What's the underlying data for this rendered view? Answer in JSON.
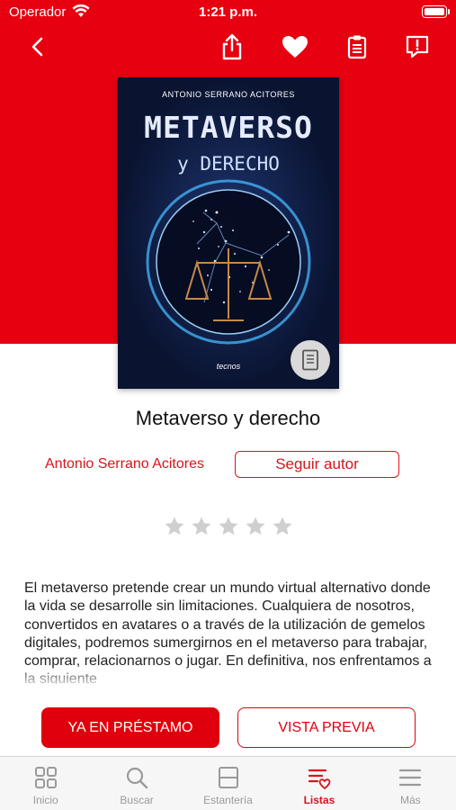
{
  "status_bar": {
    "carrier": "Operador",
    "time": "1:21 p.m."
  },
  "colors": {
    "brand_red": "#e60010",
    "accent_red": "#d8141c"
  },
  "nav": {
    "back_icon": "chevron-left-icon",
    "share_icon": "share-icon",
    "favorite_icon": "heart-icon",
    "list_icon": "clipboard-icon",
    "report_icon": "report-icon"
  },
  "book": {
    "cover_author": "ANTONIO SERRANO ACITORES",
    "cover_title": "METAVERSO",
    "cover_subtitle": "y DERECHO",
    "cover_publisher": "tecnos",
    "title": "Metaverso y derecho",
    "author": "Antonio Serrano Acitores",
    "follow_label": "Seguir autor",
    "rating": 0,
    "rating_max": 5,
    "description": "El metaverso pretende crear un mundo virtual alternativo donde la vida se desarrolle sin limitaciones. Cualquiera de nosotros, convertidos en avatares o a través de la utilización de gemelos digitales, podremos sumergirnos en el metaverso para trabajar, comprar, relacionarnos o jugar. En definitiva, nos enfrentamos a la siguiente"
  },
  "actions": {
    "primary_label": "YA EN PRÉSTAMO",
    "secondary_label": "VISTA PREVIA"
  },
  "tabbar": {
    "items": [
      {
        "label": "Inicio",
        "icon": "grid-icon"
      },
      {
        "label": "Buscar",
        "icon": "search-icon"
      },
      {
        "label": "Estantería",
        "icon": "shelf-icon"
      },
      {
        "label": "Listas",
        "icon": "list-heart-icon",
        "active": true
      },
      {
        "label": "Más",
        "icon": "menu-icon"
      }
    ]
  }
}
